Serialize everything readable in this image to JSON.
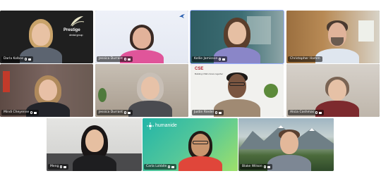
{
  "participants": [
    {
      "name": "Darla Kolbas"
    },
    {
      "name": "Jessica Durrant"
    },
    {
      "name": "Kellie Jamisson"
    },
    {
      "name": "Christopher Hamm"
    },
    {
      "name": "Mindi Cheyenne"
    },
    {
      "name": "Jessica Durrant"
    },
    {
      "name": "Justin Riedel"
    },
    {
      "name": "Alicia Coshmas"
    },
    {
      "name": "Meng"
    },
    {
      "name": "Carla LaValle"
    },
    {
      "name": "Blake Wilson"
    }
  ],
  "backgrounds": {
    "tile1_brand": "Prestige",
    "tile1_brand_sub": "dental group",
    "tile7_brand": "CSE",
    "tile7_brand_sub": "Building CSE's future together",
    "tile10_brand": "humanide"
  },
  "colors": {
    "active_speaker_outline": "#9ab1ff",
    "humanide_gradient_start": "#22b5a8",
    "humanide_gradient_end": "#9ee06a"
  },
  "icons": {
    "name_tag_mic": "microphone-icon",
    "name_tag_cam": "camera-icon",
    "tile2_logo": "bird-icon"
  }
}
